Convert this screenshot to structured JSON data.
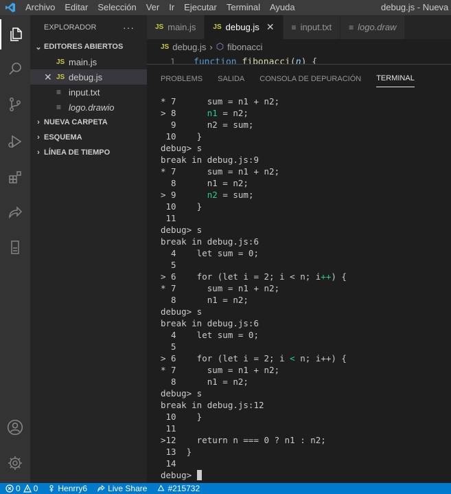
{
  "titlebar": {
    "menu": [
      "Archivo",
      "Editar",
      "Selección",
      "Ver",
      "Ir",
      "Ejecutar",
      "Terminal",
      "Ayuda"
    ],
    "window_title": "debug.js - Nueva ca"
  },
  "sidebar": {
    "header": "EXPLORADOR",
    "open_editors_label": "EDITORES ABIERTOS",
    "open_editors": [
      {
        "icon": "JS",
        "name": "main.js"
      },
      {
        "icon": "JS",
        "name": "debug.js"
      },
      {
        "icon": "lines",
        "name": "input.txt"
      },
      {
        "icon": "lines",
        "name": "logo.drawio"
      }
    ],
    "sections": [
      "NUEVA CARPETA",
      "ESQUEMA",
      "LÍNEA DE TIEMPO"
    ]
  },
  "tabs": [
    {
      "icon": "JS",
      "label": "main.js"
    },
    {
      "icon": "JS",
      "label": "debug.js"
    },
    {
      "icon": "lines",
      "label": "input.txt"
    },
    {
      "icon": "lines",
      "label": "logo.draw"
    }
  ],
  "breadcrumb": {
    "file": "debug.js",
    "symbol": "fibonacci"
  },
  "editor": {
    "line_number": "1",
    "keyword": "function",
    "function_name": "fibonacci",
    "param": "n",
    "rest": ") {"
  },
  "panel": {
    "tabs": [
      "PROBLEMS",
      "SALIDA",
      "CONSOLA DE DEPURACIÓN",
      "TERMINAL"
    ],
    "active_tab": "TERMINAL"
  },
  "terminal_lines": [
    {
      "prefix": "* 7",
      "code": "      sum = n1 + n2;",
      "hl": ""
    },
    {
      "prefix": "> 8",
      "code": "      ",
      "hl": "n1",
      "after": " = n2;"
    },
    {
      "prefix": "  9",
      "code": "      n2 = sum;",
      "hl": ""
    },
    {
      "prefix": " 10",
      "code": "    }",
      "hl": ""
    },
    {
      "prefix": "debug> s",
      "code": "",
      "hl": ""
    },
    {
      "prefix": "break in debug.js:9",
      "code": "",
      "hl": ""
    },
    {
      "prefix": "* 7",
      "code": "      sum = n1 + n2;",
      "hl": ""
    },
    {
      "prefix": "  8",
      "code": "      n1 = n2;",
      "hl": ""
    },
    {
      "prefix": "> 9",
      "code": "      ",
      "hl": "n2",
      "after": " = sum;"
    },
    {
      "prefix": " 10",
      "code": "    }",
      "hl": ""
    },
    {
      "prefix": " 11",
      "code": "",
      "hl": ""
    },
    {
      "prefix": "debug> s",
      "code": "",
      "hl": ""
    },
    {
      "prefix": "break in debug.js:6",
      "code": "",
      "hl": ""
    },
    {
      "prefix": "  4",
      "code": "    let sum = 0;",
      "hl": ""
    },
    {
      "prefix": "  5",
      "code": "",
      "hl": ""
    },
    {
      "prefix": "> 6",
      "code": "    for (let i = 2; i < n; i",
      "hl": "++",
      "after": ") {"
    },
    {
      "prefix": "* 7",
      "code": "      sum = n1 + n2;",
      "hl": ""
    },
    {
      "prefix": "  8",
      "code": "      n1 = n2;",
      "hl": ""
    },
    {
      "prefix": "debug> s",
      "code": "",
      "hl": ""
    },
    {
      "prefix": "break in debug.js:6",
      "code": "",
      "hl": ""
    },
    {
      "prefix": "  4",
      "code": "    let sum = 0;",
      "hl": ""
    },
    {
      "prefix": "  5",
      "code": "",
      "hl": ""
    },
    {
      "prefix": "> 6",
      "code": "    for (let i = 2; i ",
      "hl": "<",
      "after": " n; i++) {"
    },
    {
      "prefix": "* 7",
      "code": "      sum = n1 + n2;",
      "hl": ""
    },
    {
      "prefix": "  8",
      "code": "      n1 = n2;",
      "hl": ""
    },
    {
      "prefix": "debug> s",
      "code": "",
      "hl": ""
    },
    {
      "prefix": "break in debug.js:12",
      "code": "",
      "hl": ""
    },
    {
      "prefix": " 10",
      "code": "    }",
      "hl": ""
    },
    {
      "prefix": " 11",
      "code": "",
      "hl": ""
    },
    {
      "prefix": ">12",
      "code": "    return n === 0 ? n1 : n2;",
      "hl": ""
    },
    {
      "prefix": " 13",
      "code": "  }",
      "hl": ""
    },
    {
      "prefix": " 14",
      "code": "",
      "hl": ""
    },
    {
      "prefix": "debug> ",
      "code": "",
      "hl": "",
      "cursor": true
    }
  ],
  "statusbar": {
    "errors": "0",
    "warnings": "0",
    "user": "Henrry6",
    "live_share": "Live Share",
    "number": "#215732"
  },
  "colors": {
    "accent": "#007acc",
    "highlight": "#23d18b",
    "js_icon": "#cbcb41"
  }
}
